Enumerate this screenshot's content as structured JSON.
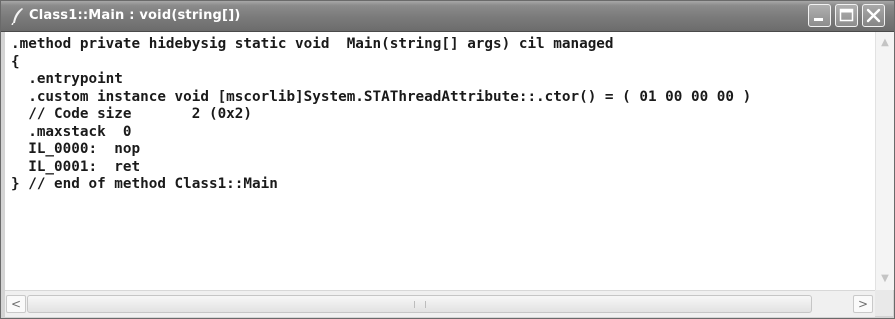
{
  "window": {
    "title": "Class1::Main : void(string[])",
    "controls": {
      "minimize": "minimize",
      "maximize": "maximize",
      "close": "close"
    }
  },
  "code_lines": [
    ".method private hidebysig static void  Main(string[] args) cil managed",
    "{",
    "  .entrypoint",
    "  .custom instance void [mscorlib]System.STAThreadAttribute::.ctor() = ( 01 00 00 00 )",
    "  // Code size       2 (0x2)",
    "  .maxstack  0",
    "  IL_0000:  nop",
    "  IL_0001:  ret",
    "} // end of method Class1::Main"
  ],
  "icons": {
    "app": "quill-pen-icon",
    "scroll_up": "arrow-up-icon",
    "scroll_down": "arrow-down-icon",
    "scroll_left": "arrow-left-icon",
    "scroll_right": "arrow-right-icon"
  },
  "colors": {
    "titlebar": "#7a7a7a",
    "title_text": "#ffffff",
    "code_text": "#1a1a1a",
    "background": "#ffffff"
  }
}
